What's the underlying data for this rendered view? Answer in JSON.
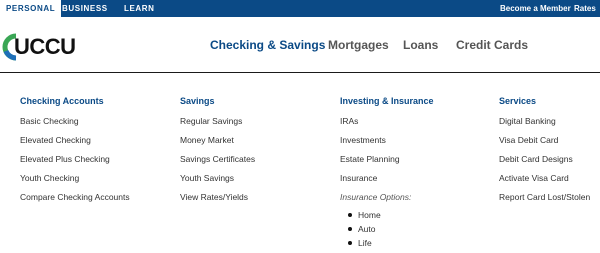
{
  "topbar": {
    "tabs": [
      {
        "label": "PERSONAL",
        "active": true
      },
      {
        "label": "BUSINESS",
        "active": false
      },
      {
        "label": "LEARN",
        "active": false
      }
    ],
    "utility": {
      "member": "Become a Member",
      "rates": "Rates"
    }
  },
  "logo": {
    "text": "UCCU"
  },
  "mainnav": [
    {
      "label": "Checking & Savings",
      "active": true
    },
    {
      "label": "Mortgages",
      "active": false
    },
    {
      "label": "Loans",
      "active": false
    },
    {
      "label": "Credit Cards",
      "active": false
    }
  ],
  "menu": {
    "checking": {
      "heading": "Checking Accounts",
      "links": [
        "Basic Checking",
        "Elevated Checking",
        "Elevated Plus Checking",
        "Youth Checking",
        "Compare Checking Accounts"
      ]
    },
    "savings": {
      "heading": "Savings",
      "links": [
        "Regular Savings",
        "Money Market",
        "Savings Certificates",
        "Youth Savings",
        "View Rates/Yields"
      ]
    },
    "investing": {
      "heading": "Investing & Insurance",
      "links": [
        "IRAs",
        "Investments",
        "Estate Planning",
        "Insurance"
      ],
      "note": "Insurance Options:",
      "options": [
        "Home",
        "Auto",
        "Life"
      ]
    },
    "services": {
      "heading": "Services",
      "links": [
        "Digital Banking",
        "Visa Debit Card",
        "Debit Card Designs",
        "Activate Visa Card",
        "Report Card Lost/Stolen"
      ]
    }
  },
  "colors": {
    "brand_blue": "#0b4a86",
    "logo_green": "#3aa655",
    "logo_blue": "#1f6fb8"
  }
}
